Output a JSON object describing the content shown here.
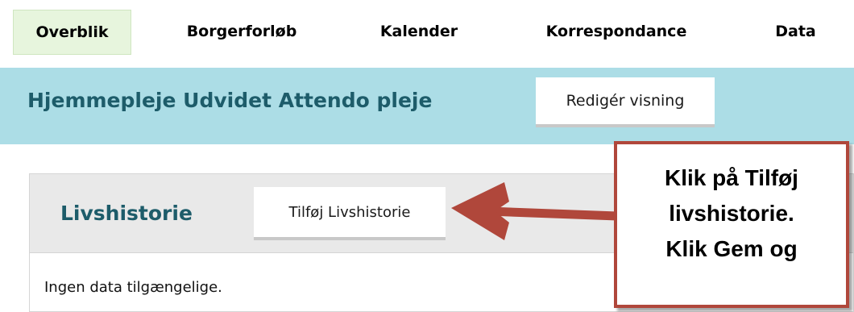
{
  "nav": {
    "items": [
      {
        "label": "Overblik",
        "active": true
      },
      {
        "label": "Borgerforløb",
        "active": false
      },
      {
        "label": "Kalender",
        "active": false
      },
      {
        "label": "Korrespondance",
        "active": false
      },
      {
        "label": "Data",
        "active": false
      }
    ]
  },
  "header": {
    "title": "Hjemmepleje Udvidet Attendo pleje",
    "edit_view_label": "Redigér visning"
  },
  "panel": {
    "title": "Livshistorie",
    "add_button_label": "Tilføj Livshistorie",
    "empty_text": "Ingen data tilgængelige."
  },
  "callout": {
    "lines": [
      "Klik på Tilføj",
      "livshistorie.",
      "Klik Gem og"
    ]
  },
  "colors": {
    "header_band": "#acdde6",
    "title_teal": "#1d5c6a",
    "active_nav": "#e7f5dd",
    "annotation_red": "#b0473b"
  }
}
